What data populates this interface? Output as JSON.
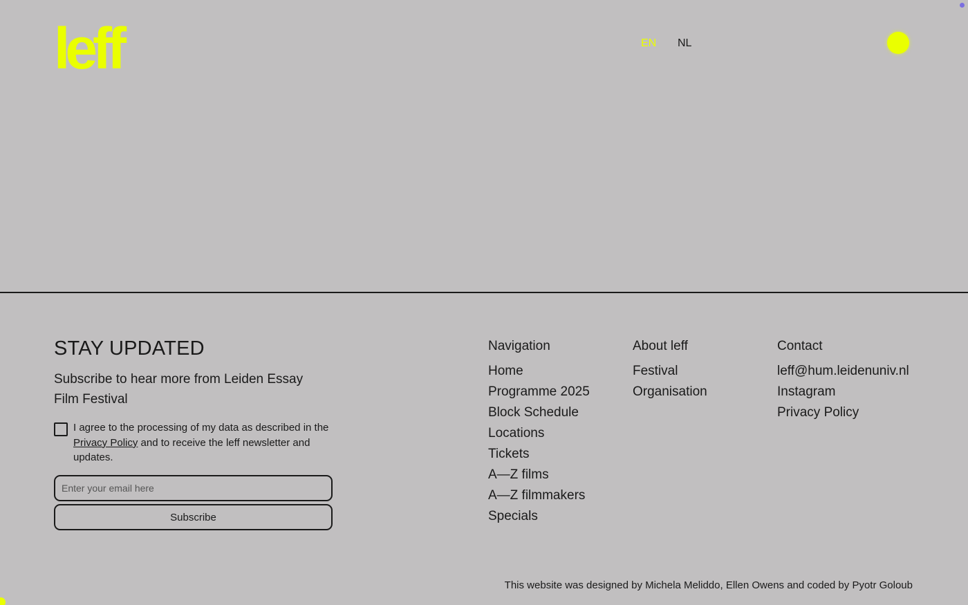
{
  "header": {
    "logo": "leff",
    "languages": [
      {
        "label": "EN",
        "active": true
      },
      {
        "label": "NL",
        "active": false
      }
    ],
    "menu_icon": "yellow-circle-icon",
    "accent_color": "#eaff00"
  },
  "newsletter": {
    "title": "STAY UPDATED",
    "subtitle": "Subscribe to hear more from Leiden Essay Film Festival",
    "consent_before": "I agree to the processing of my data as described in the ",
    "consent_link": "Privacy Policy",
    "consent_after": " and to receive the leff newsletter and updates.",
    "email_placeholder": "Enter your email here",
    "email_value": "",
    "subscribe_label": "Subscribe"
  },
  "footer": {
    "navigation": {
      "title": "Navigation",
      "items": [
        "Home",
        "Programme 2025",
        "Block Schedule",
        "Locations",
        "Tickets",
        "A—Z films",
        "A—Z filmmakers",
        "Specials"
      ]
    },
    "about": {
      "title": "About leff",
      "items": [
        "Festival",
        "Organisation"
      ]
    },
    "contact": {
      "title": "Contact",
      "items": [
        "leff@hum.leidenuniv.nl",
        "Instagram",
        "Privacy Policy"
      ]
    },
    "credits": "This website was designed by Michela Meliddo, Ellen Owens and coded by Pyotr Goloub"
  },
  "colors": {
    "background": "#c1bfc0",
    "text": "#1a1a1a",
    "accent": "#eaff00",
    "indicator": "#7b6fe0"
  }
}
